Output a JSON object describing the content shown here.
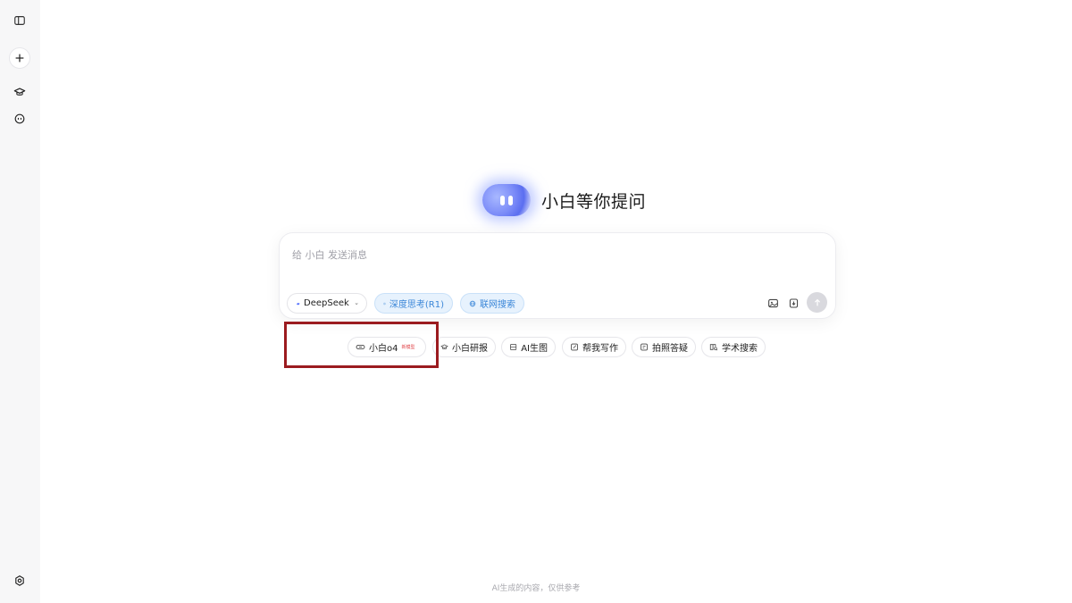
{
  "sidebar": {
    "icons": [
      "panel-toggle-icon",
      "plus-icon",
      "graduation-cap-icon",
      "bot-face-icon",
      "settings-icon"
    ]
  },
  "hero": {
    "title": "小白等你提问"
  },
  "composer": {
    "placeholder": "给 小白 发送消息",
    "model_label": "DeepSeek",
    "deep_think_label": "深度思考(R1)",
    "web_search_label": "联网搜索"
  },
  "quick_actions": {
    "o4_label": "小白o4",
    "o4_badge": "新模型",
    "research_label": "小白研报",
    "image_gen_label": "AI生图",
    "writing_label": "帮我写作",
    "photo_qa_label": "拍照答疑",
    "academic_label": "学术搜索"
  },
  "footer": {
    "disclaimer": "AI生成的内容，仅供参考"
  },
  "colors": {
    "accent": "#3a86d8",
    "highlight_box": "#9b1b1f",
    "badge": "#e0454a"
  }
}
